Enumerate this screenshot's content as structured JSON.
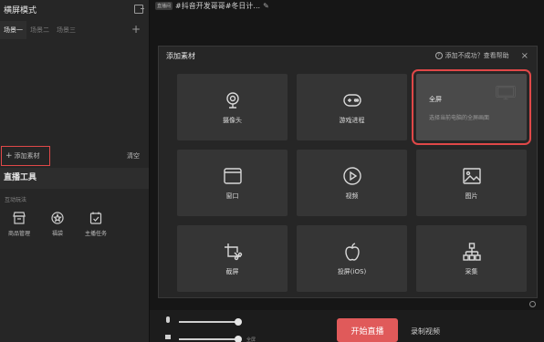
{
  "left_panel": {
    "mode_title": "横屏模式",
    "scenes": [
      "场景一",
      "场景二",
      "场景三"
    ],
    "scene_add": "+",
    "add_source": {
      "icon": "+",
      "label": "添加素材"
    },
    "clear_label": "清空",
    "live_tools_title": "直播工具",
    "interact_label": "互动玩法",
    "tools": [
      {
        "icon": "shop-icon",
        "label": "商品管理"
      },
      {
        "icon": "badge-icon",
        "label": "福袋"
      },
      {
        "icon": "task-icon",
        "label": "主播任务"
      }
    ]
  },
  "topbar": {
    "room_badge": "直播间",
    "room_title": "#抖音开发哥哥#冬日计..."
  },
  "dialog": {
    "title": "添加素材",
    "help_text": "添加不成功？查看帮助",
    "close": "×",
    "fullscreen": {
      "title": "全屏",
      "desc": "选择当前电脑的全屏画面"
    },
    "items": [
      {
        "icon": "camera-icon",
        "label": "摄像头"
      },
      {
        "icon": "gamepad-icon",
        "label": "游戏进程"
      },
      {
        "icon": "window-icon",
        "label": "窗口"
      },
      {
        "icon": "play-icon",
        "label": "视频"
      },
      {
        "icon": "image-icon",
        "label": "图片"
      },
      {
        "icon": "screenshot-icon",
        "label": "截屏"
      },
      {
        "icon": "apple-icon",
        "label": "投屏(iOS)"
      },
      {
        "icon": "capture-icon",
        "label": "采集"
      }
    ]
  },
  "bottom": {
    "start_label": "开始直播",
    "record_label": "录制视频",
    "tiny_tag": "全屏"
  },
  "colors": {
    "accent": "#e05a5a",
    "highlight_border": "#e04848"
  }
}
